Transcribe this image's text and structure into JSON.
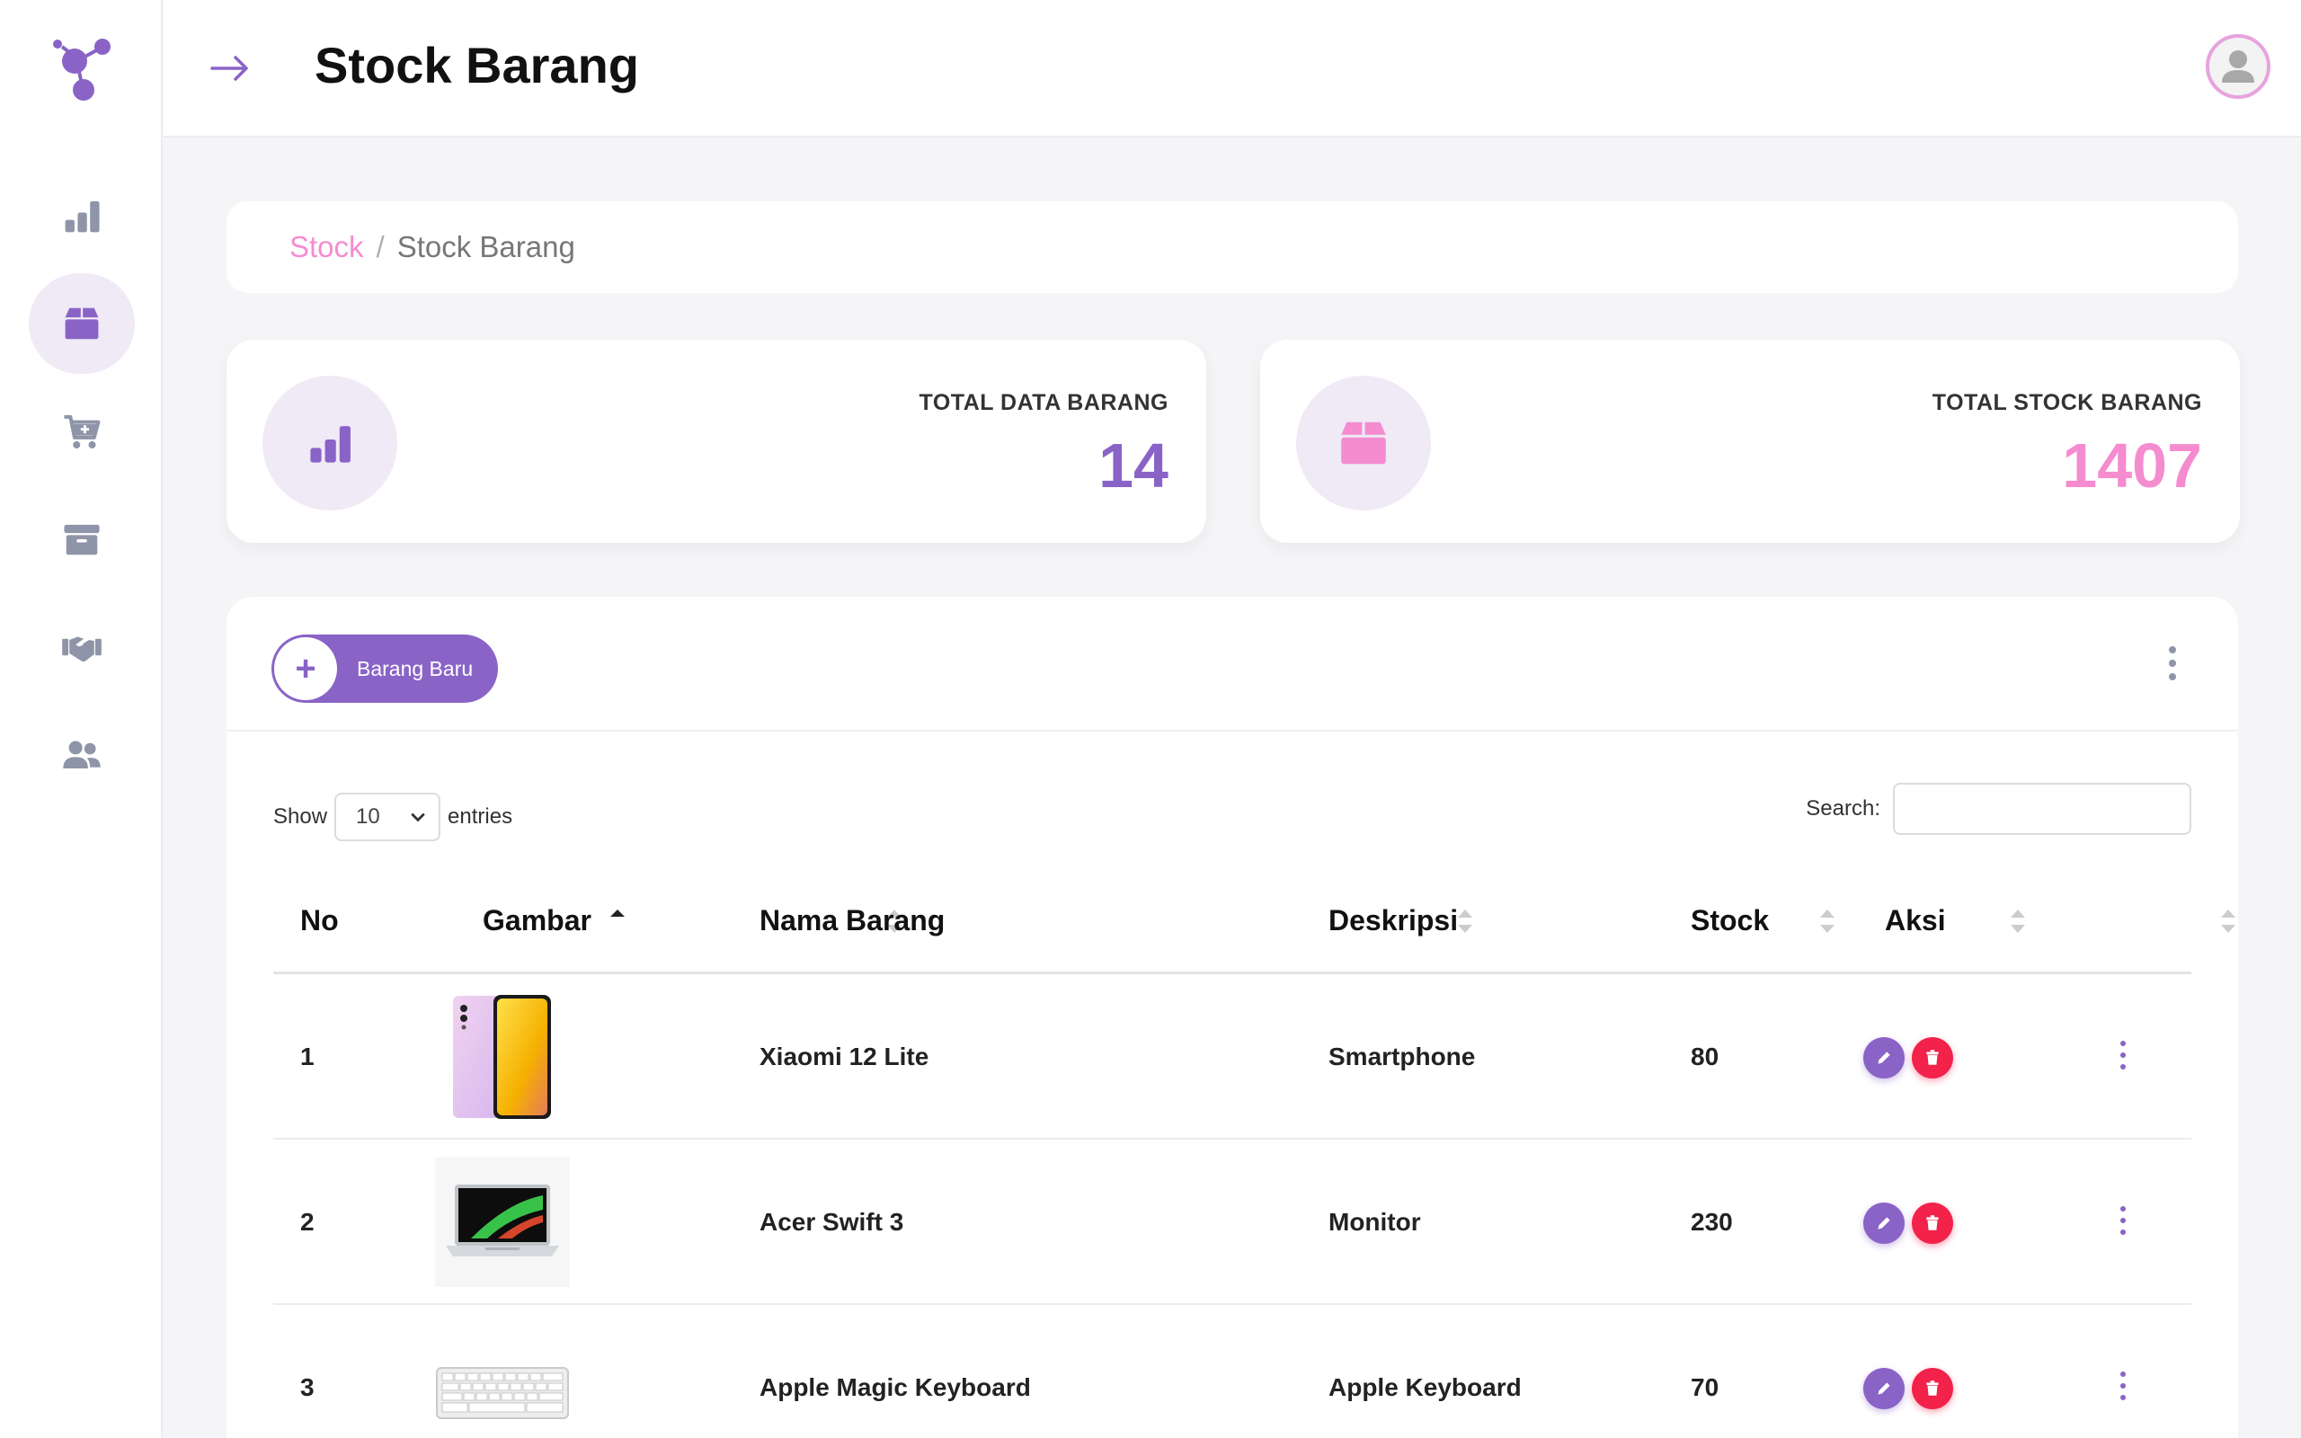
{
  "header": {
    "title": "Stock Barang"
  },
  "sidebar": {
    "items": [
      {
        "name": "dashboard",
        "icon": "bar-chart-icon"
      },
      {
        "name": "stock",
        "icon": "box-icon",
        "active": true
      },
      {
        "name": "purchase",
        "icon": "cart-plus-icon"
      },
      {
        "name": "archive",
        "icon": "archive-icon"
      },
      {
        "name": "partners",
        "icon": "handshake-icon"
      },
      {
        "name": "users",
        "icon": "users-icon"
      }
    ]
  },
  "breadcrumb": {
    "parent": "Stock",
    "separator": "/",
    "current": "Stock Barang"
  },
  "stats": {
    "total_data": {
      "label": "TOTAL DATA BARANG",
      "value": "14",
      "color": "#8a63c7"
    },
    "total_stock": {
      "label": "TOTAL STOCK BARANG",
      "value": "1407",
      "color": "#f58ccf"
    }
  },
  "table_card": {
    "new_button_label": "Barang Baru",
    "show_label": "Show",
    "entries_value": "10",
    "entries_label": "entries",
    "search_label": "Search:",
    "search_value": ""
  },
  "table": {
    "columns": [
      "No",
      "Gambar",
      "Nama Barang",
      "Deskripsi",
      "Stock",
      "Aksi"
    ],
    "rows": [
      {
        "no": "1",
        "image": "smartphone-image",
        "name": "Xiaomi 12 Lite",
        "desc": "Smartphone",
        "stock": "80"
      },
      {
        "no": "2",
        "image": "laptop-image",
        "name": "Acer Swift 3",
        "desc": "Monitor",
        "stock": "230"
      },
      {
        "no": "3",
        "image": "keyboard-image",
        "name": "Apple Magic Keyboard",
        "desc": "Apple Keyboard",
        "stock": "70"
      }
    ]
  },
  "colors": {
    "accent": "#8a63c7",
    "pink": "#f58ccf",
    "danger": "#f2224a",
    "nav_icon": "#8e95a8"
  }
}
